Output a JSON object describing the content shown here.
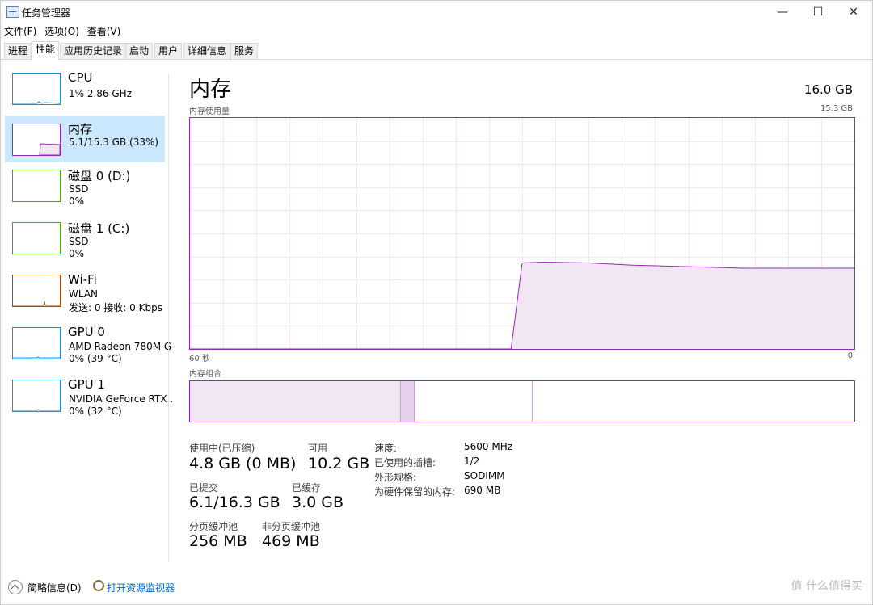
{
  "window": {
    "title": "任务管理器",
    "min_icon": "—",
    "max_icon": "☐",
    "close_icon": "✕"
  },
  "menu": [
    "文件(F)",
    "选项(O)",
    "查看(V)"
  ],
  "tabs": [
    "进程",
    "性能",
    "应用历史记录",
    "启动",
    "用户",
    "详细信息",
    "服务"
  ],
  "active_tab": "性能",
  "sidebar": {
    "items": [
      {
        "name": "CPU",
        "line1": "1% 2.86 GHz",
        "line2": "",
        "color": "#1f8ecd"
      },
      {
        "name": "内存",
        "line1": "5.1/15.3 GB (33%)",
        "line2": "",
        "color": "#9528b4"
      },
      {
        "name": "磁盘 0 (D:)",
        "line1": "SSD",
        "line2": "0%",
        "color": "#4da60c"
      },
      {
        "name": "磁盘 1 (C:)",
        "line1": "SSD",
        "line2": "0%",
        "color": "#4da60c"
      },
      {
        "name": "Wi-Fi",
        "line1": "WLAN",
        "line2": "发送: 0 接收: 0 Kbps",
        "color": "#a74f01"
      },
      {
        "name": "GPU 0",
        "line1": "AMD Radeon 780M G",
        "line2": "0% (39 °C)",
        "color": "#1f8ecd"
      },
      {
        "name": "GPU 1",
        "line1": "NVIDIA GeForce RTX .",
        "line2": "0% (32 °C)",
        "color": "#1f8ecd"
      }
    ]
  },
  "main": {
    "title": "内存",
    "total": "16.0 GB",
    "usage_label": "内存使用量",
    "usage_max": "15.3 GB",
    "x_left": "60 秒",
    "x_right": "0",
    "composition_label": "内存组合",
    "accent": "#9528b4",
    "stats": {
      "in_use_label": "使用中(已压缩)",
      "in_use_value": "4.8 GB (0 MB)",
      "available_label": "可用",
      "available_value": "10.2 GB",
      "committed_label": "已提交",
      "committed_value": "6.1/16.3 GB",
      "cached_label": "已缓存",
      "cached_value": "3.0 GB",
      "paged_label": "分页缓冲池",
      "paged_value": "256 MB",
      "nonpaged_label": "非分页缓冲池",
      "nonpaged_value": "469 MB"
    },
    "details": [
      {
        "label": "速度:",
        "value": "5600 MHz"
      },
      {
        "label": "已使用的插槽:",
        "value": "1/2"
      },
      {
        "label": "外形规格:",
        "value": "SODIMM"
      },
      {
        "label": "为硬件保留的内存:",
        "value": "690 MB"
      }
    ]
  },
  "chart_data": {
    "type": "area",
    "x_range_seconds": [
      60,
      0
    ],
    "ylim_gb": [
      0,
      15.3
    ],
    "x_seconds_ago": [
      60,
      31,
      30,
      28,
      24,
      20,
      15,
      10,
      5,
      0
    ],
    "y_gb": [
      0,
      0,
      5.7,
      5.75,
      5.7,
      5.55,
      5.45,
      5.35,
      5.35,
      5.35
    ]
  },
  "footer": {
    "summary": "简略信息(D)",
    "resmon": "打开资源监视器",
    "watermark": "值 什么值得买"
  }
}
